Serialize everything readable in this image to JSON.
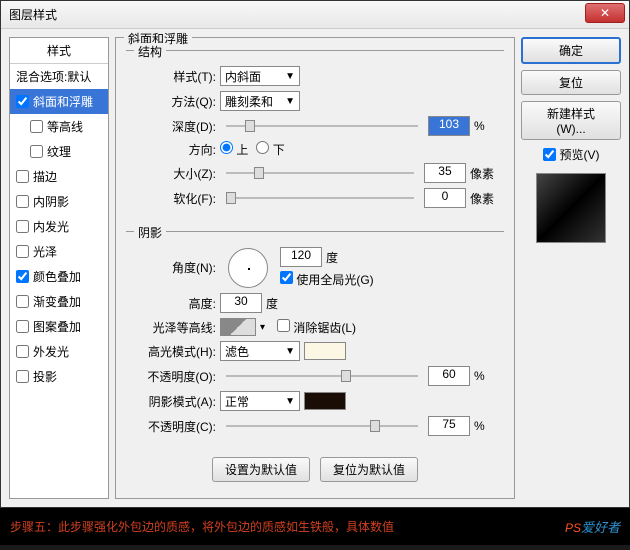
{
  "window": {
    "title": "图层样式"
  },
  "sidebar": {
    "header": "样式",
    "blending": "混合选项:默认",
    "items": [
      {
        "label": "斜面和浮雕",
        "checked": true,
        "selected": true
      },
      {
        "label": "等高线",
        "checked": false,
        "sub": true
      },
      {
        "label": "纹理",
        "checked": false,
        "sub": true
      },
      {
        "label": "描边",
        "checked": false
      },
      {
        "label": "内阴影",
        "checked": false
      },
      {
        "label": "内发光",
        "checked": false
      },
      {
        "label": "光泽",
        "checked": false
      },
      {
        "label": "颜色叠加",
        "checked": true
      },
      {
        "label": "渐变叠加",
        "checked": false
      },
      {
        "label": "图案叠加",
        "checked": false
      },
      {
        "label": "外发光",
        "checked": false
      },
      {
        "label": "投影",
        "checked": false
      }
    ]
  },
  "main": {
    "section_title": "斜面和浮雕",
    "structure": {
      "title": "结构",
      "style_label": "样式(T):",
      "style_value": "内斜面",
      "technique_label": "方法(Q):",
      "technique_value": "雕刻柔和",
      "depth_label": "深度(D):",
      "depth_value": "103",
      "depth_unit": "%",
      "direction_label": "方向:",
      "up": "上",
      "down": "下",
      "size_label": "大小(Z):",
      "size_value": "35",
      "size_unit": "像素",
      "soften_label": "软化(F):",
      "soften_value": "0",
      "soften_unit": "像素"
    },
    "shading": {
      "title": "阴影",
      "angle_label": "角度(N):",
      "angle_value": "120",
      "angle_unit": "度",
      "global_light": "使用全局光(G)",
      "altitude_label": "高度:",
      "altitude_value": "30",
      "altitude_unit": "度",
      "gloss_label": "光泽等高线:",
      "antialias": "消除锯齿(L)",
      "highlight_mode_label": "高光模式(H):",
      "highlight_mode_value": "滤色",
      "highlight_opacity_label": "不透明度(O):",
      "highlight_opacity_value": "60",
      "opacity_unit": "%",
      "shadow_mode_label": "阴影模式(A):",
      "shadow_mode_value": "正常",
      "shadow_opacity_label": "不透明度(C):",
      "shadow_opacity_value": "75"
    },
    "buttons": {
      "default": "设置为默认值",
      "reset": "复位为默认值"
    }
  },
  "right": {
    "ok": "确定",
    "cancel": "复位",
    "new_style": "新建样式(W)...",
    "preview_label": "预览(V)"
  },
  "footer": {
    "text": "步骤五：此步骤强化外包边的质感，将外包边的质感如生铁般，具体数值",
    "logo_ps": "PS",
    "logo_suffix": "爱好者"
  },
  "colors": {
    "highlight_color": "#fbf7e4",
    "shadow_color": "#1a0d05"
  }
}
